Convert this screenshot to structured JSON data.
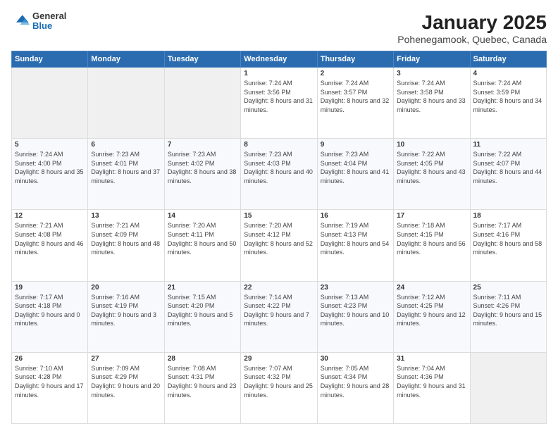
{
  "logo": {
    "general": "General",
    "blue": "Blue"
  },
  "title": "January 2025",
  "subtitle": "Pohenegamook, Quebec, Canada",
  "days_of_week": [
    "Sunday",
    "Monday",
    "Tuesday",
    "Wednesday",
    "Thursday",
    "Friday",
    "Saturday"
  ],
  "weeks": [
    [
      {
        "day": "",
        "info": ""
      },
      {
        "day": "",
        "info": ""
      },
      {
        "day": "",
        "info": ""
      },
      {
        "day": "1",
        "info": "Sunrise: 7:24 AM\nSunset: 3:56 PM\nDaylight: 8 hours and 31 minutes."
      },
      {
        "day": "2",
        "info": "Sunrise: 7:24 AM\nSunset: 3:57 PM\nDaylight: 8 hours and 32 minutes."
      },
      {
        "day": "3",
        "info": "Sunrise: 7:24 AM\nSunset: 3:58 PM\nDaylight: 8 hours and 33 minutes."
      },
      {
        "day": "4",
        "info": "Sunrise: 7:24 AM\nSunset: 3:59 PM\nDaylight: 8 hours and 34 minutes."
      }
    ],
    [
      {
        "day": "5",
        "info": "Sunrise: 7:24 AM\nSunset: 4:00 PM\nDaylight: 8 hours and 35 minutes."
      },
      {
        "day": "6",
        "info": "Sunrise: 7:23 AM\nSunset: 4:01 PM\nDaylight: 8 hours and 37 minutes."
      },
      {
        "day": "7",
        "info": "Sunrise: 7:23 AM\nSunset: 4:02 PM\nDaylight: 8 hours and 38 minutes."
      },
      {
        "day": "8",
        "info": "Sunrise: 7:23 AM\nSunset: 4:03 PM\nDaylight: 8 hours and 40 minutes."
      },
      {
        "day": "9",
        "info": "Sunrise: 7:23 AM\nSunset: 4:04 PM\nDaylight: 8 hours and 41 minutes."
      },
      {
        "day": "10",
        "info": "Sunrise: 7:22 AM\nSunset: 4:05 PM\nDaylight: 8 hours and 43 minutes."
      },
      {
        "day": "11",
        "info": "Sunrise: 7:22 AM\nSunset: 4:07 PM\nDaylight: 8 hours and 44 minutes."
      }
    ],
    [
      {
        "day": "12",
        "info": "Sunrise: 7:21 AM\nSunset: 4:08 PM\nDaylight: 8 hours and 46 minutes."
      },
      {
        "day": "13",
        "info": "Sunrise: 7:21 AM\nSunset: 4:09 PM\nDaylight: 8 hours and 48 minutes."
      },
      {
        "day": "14",
        "info": "Sunrise: 7:20 AM\nSunset: 4:11 PM\nDaylight: 8 hours and 50 minutes."
      },
      {
        "day": "15",
        "info": "Sunrise: 7:20 AM\nSunset: 4:12 PM\nDaylight: 8 hours and 52 minutes."
      },
      {
        "day": "16",
        "info": "Sunrise: 7:19 AM\nSunset: 4:13 PM\nDaylight: 8 hours and 54 minutes."
      },
      {
        "day": "17",
        "info": "Sunrise: 7:18 AM\nSunset: 4:15 PM\nDaylight: 8 hours and 56 minutes."
      },
      {
        "day": "18",
        "info": "Sunrise: 7:17 AM\nSunset: 4:16 PM\nDaylight: 8 hours and 58 minutes."
      }
    ],
    [
      {
        "day": "19",
        "info": "Sunrise: 7:17 AM\nSunset: 4:18 PM\nDaylight: 9 hours and 0 minutes."
      },
      {
        "day": "20",
        "info": "Sunrise: 7:16 AM\nSunset: 4:19 PM\nDaylight: 9 hours and 3 minutes."
      },
      {
        "day": "21",
        "info": "Sunrise: 7:15 AM\nSunset: 4:20 PM\nDaylight: 9 hours and 5 minutes."
      },
      {
        "day": "22",
        "info": "Sunrise: 7:14 AM\nSunset: 4:22 PM\nDaylight: 9 hours and 7 minutes."
      },
      {
        "day": "23",
        "info": "Sunrise: 7:13 AM\nSunset: 4:23 PM\nDaylight: 9 hours and 10 minutes."
      },
      {
        "day": "24",
        "info": "Sunrise: 7:12 AM\nSunset: 4:25 PM\nDaylight: 9 hours and 12 minutes."
      },
      {
        "day": "25",
        "info": "Sunrise: 7:11 AM\nSunset: 4:26 PM\nDaylight: 9 hours and 15 minutes."
      }
    ],
    [
      {
        "day": "26",
        "info": "Sunrise: 7:10 AM\nSunset: 4:28 PM\nDaylight: 9 hours and 17 minutes."
      },
      {
        "day": "27",
        "info": "Sunrise: 7:09 AM\nSunset: 4:29 PM\nDaylight: 9 hours and 20 minutes."
      },
      {
        "day": "28",
        "info": "Sunrise: 7:08 AM\nSunset: 4:31 PM\nDaylight: 9 hours and 23 minutes."
      },
      {
        "day": "29",
        "info": "Sunrise: 7:07 AM\nSunset: 4:32 PM\nDaylight: 9 hours and 25 minutes."
      },
      {
        "day": "30",
        "info": "Sunrise: 7:05 AM\nSunset: 4:34 PM\nDaylight: 9 hours and 28 minutes."
      },
      {
        "day": "31",
        "info": "Sunrise: 7:04 AM\nSunset: 4:36 PM\nDaylight: 9 hours and 31 minutes."
      },
      {
        "day": "",
        "info": ""
      }
    ]
  ]
}
